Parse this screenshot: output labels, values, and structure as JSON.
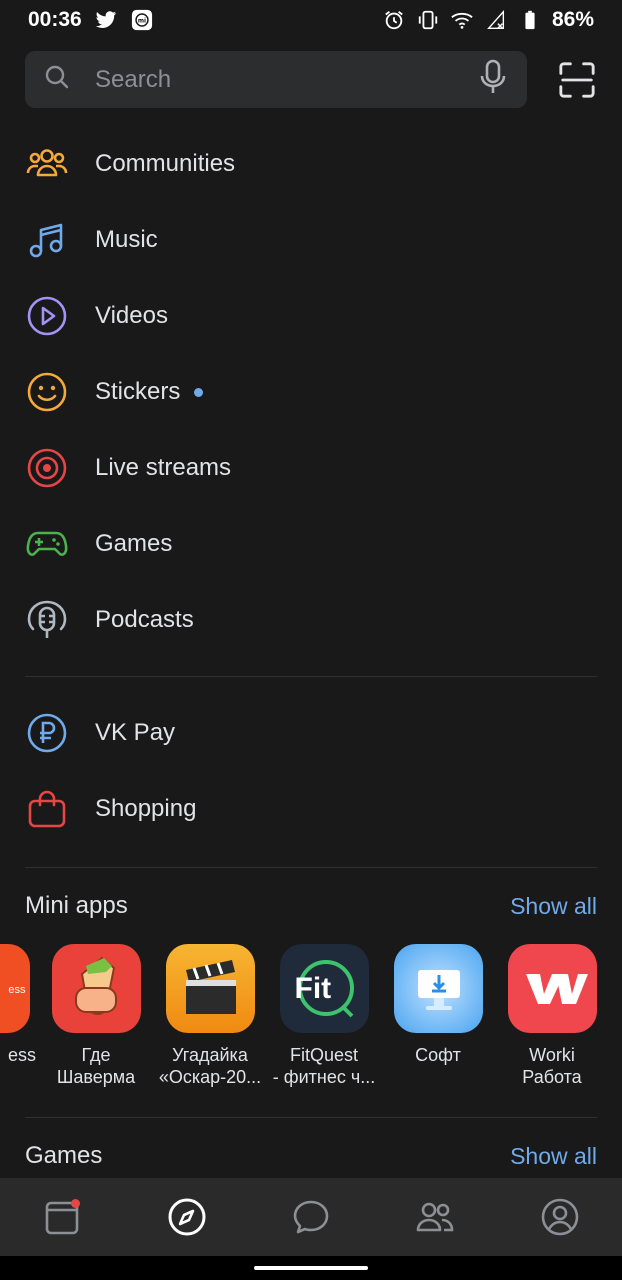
{
  "status_bar": {
    "time": "00:36",
    "battery": "86%",
    "left_icons": [
      "twitter-icon",
      "mi-icon"
    ],
    "right_icons": [
      "alarm-icon",
      "vibrate-icon",
      "wifi-icon",
      "signal-icon",
      "battery-icon"
    ]
  },
  "search": {
    "placeholder": "Search",
    "value": ""
  },
  "menu": {
    "items": [
      {
        "label": "Communities",
        "icon": "communities-icon",
        "color": "#f5a93a"
      },
      {
        "label": "Music",
        "icon": "music-icon",
        "color": "#71aaeb"
      },
      {
        "label": "Videos",
        "icon": "videos-icon",
        "color": "#a393f5"
      },
      {
        "label": "Stickers",
        "icon": "stickers-icon",
        "color": "#f5a93a",
        "has_dot": true
      },
      {
        "label": "Live streams",
        "icon": "live-streams-icon",
        "color": "#e64646"
      },
      {
        "label": "Games",
        "icon": "games-icon",
        "color": "#4bb34b"
      },
      {
        "label": "Podcasts",
        "icon": "podcasts-icon",
        "color": "#aeb7c2"
      }
    ],
    "secondary_items": [
      {
        "label": "VK Pay",
        "icon": "vk-pay-icon",
        "color": "#71aaeb"
      },
      {
        "label": "Shopping",
        "icon": "shopping-icon",
        "color": "#e64646"
      }
    ]
  },
  "mini_apps": {
    "title": "Mini apps",
    "show_all": "Show all",
    "apps": [
      {
        "name_line1": "ess",
        "name_line2": "",
        "icon": "express-app-icon",
        "logo_text": "ess",
        "color": "#f04e23"
      },
      {
        "name_line1": "Где",
        "name_line2": "Шаверма",
        "icon": "shawarma-app-icon",
        "color": "#e9423b"
      },
      {
        "name_line1": "Угадайка",
        "name_line2": "«Оскар-20...",
        "icon": "clapperboard-app-icon",
        "color": "#f59a1b"
      },
      {
        "name_line1": "FitQuest",
        "name_line2": "- фитнес ч...",
        "icon": "fitquest-app-icon",
        "logo_text": "Fit",
        "color": "#1f2a3a"
      },
      {
        "name_line1": "Софт",
        "name_line2": "",
        "icon": "soft-app-icon",
        "color": "#4aa4f0"
      },
      {
        "name_line1": "Worki",
        "name_line2": "Работа",
        "icon": "worki-app-icon",
        "color": "#f0464e"
      }
    ]
  },
  "games_section": {
    "title": "Games",
    "show_all": "Show all"
  },
  "tab_bar": {
    "tabs": [
      "news-tab-icon",
      "discover-tab-icon",
      "messages-tab-icon",
      "friends-tab-icon",
      "profile-tab-icon"
    ],
    "active": "discover-tab-icon",
    "accent": "#ffffff",
    "badge_color": "#e64646"
  }
}
